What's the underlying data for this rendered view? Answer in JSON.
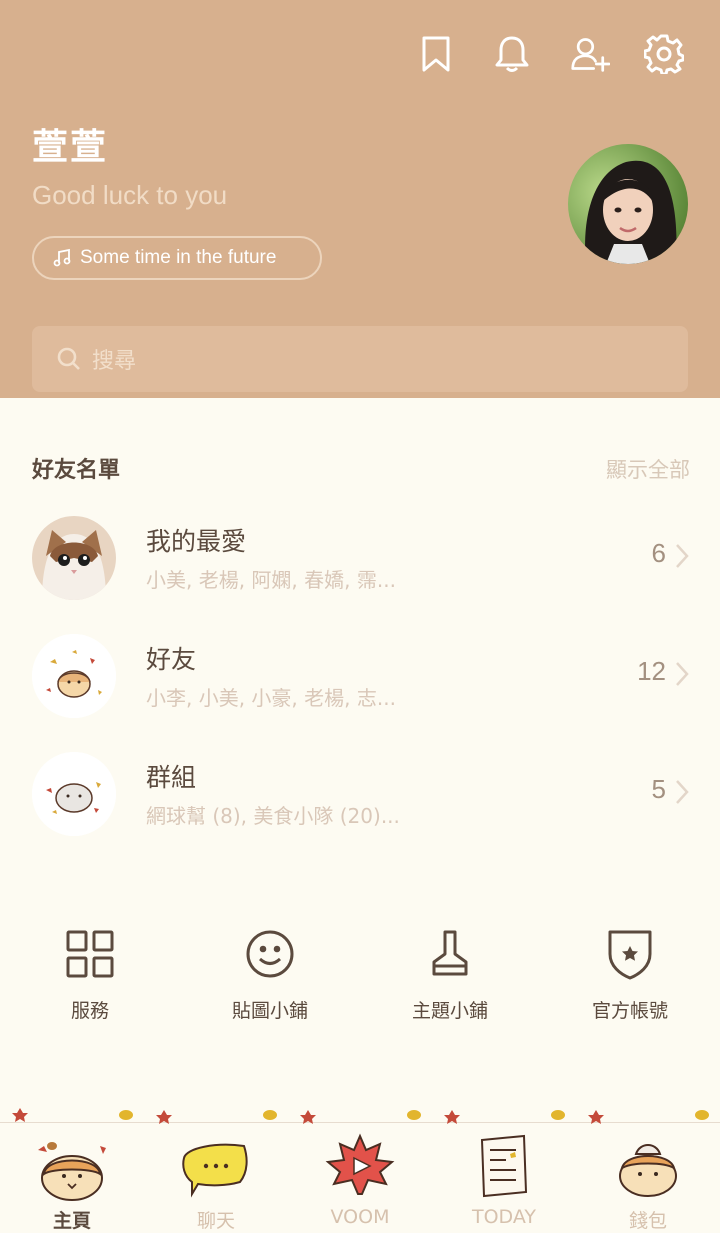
{
  "profile": {
    "name": "萱萱",
    "status": "Good luck to you",
    "music": "Some time in the future"
  },
  "header_icons": [
    "bookmark-icon",
    "bell-icon",
    "add-friend-icon",
    "settings-icon"
  ],
  "search": {
    "placeholder": "搜尋"
  },
  "friends_section": {
    "title": "好友名單",
    "show_all": "顯示全部",
    "rows": [
      {
        "title": "我的最愛",
        "subtitle": "小美, 老楊, 阿嫻, 春嬌, 霈...",
        "count": "6"
      },
      {
        "title": "好友",
        "subtitle": "小李, 小美, 小豪, 老楊, 志...",
        "count": "12"
      },
      {
        "title": "群組",
        "subtitle": "網球幫 (8), 美食小隊 (20)...",
        "count": "5"
      }
    ]
  },
  "shortcuts": [
    {
      "label": "服務",
      "icon": "grid-icon"
    },
    {
      "label": "貼圖小鋪",
      "icon": "smiley-icon"
    },
    {
      "label": "主題小鋪",
      "icon": "brush-icon"
    },
    {
      "label": "官方帳號",
      "icon": "shield-star-icon"
    }
  ],
  "nav": [
    {
      "label": "主頁",
      "active": true
    },
    {
      "label": "聊天",
      "active": false
    },
    {
      "label": "VOOM",
      "active": false
    },
    {
      "label": "TODAY",
      "active": false
    },
    {
      "label": "錢包",
      "active": false
    }
  ],
  "colors": {
    "header_bg": "#d7b08e",
    "page_bg": "#fdfbf2",
    "text_dark": "#5b4a3e",
    "text_light": "#d9c7b8"
  }
}
